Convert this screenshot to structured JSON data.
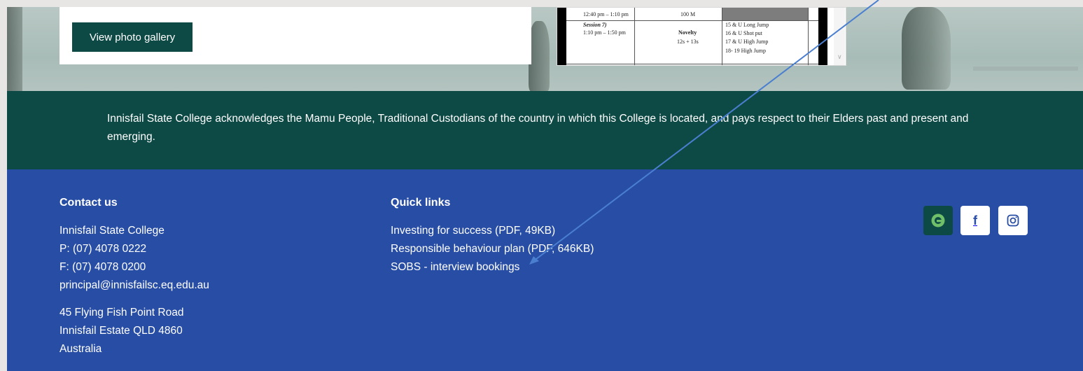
{
  "hero": {
    "gallery_button": "View photo gallery"
  },
  "schedule": {
    "rows": [
      {
        "time": "12:40 pm – 1:10 pm",
        "event": "100 M",
        "events": []
      },
      {
        "session": "Session 7)",
        "time": "1:10 pm – 1:50 pm",
        "event": "Novelty",
        "group": "12s + 13s",
        "events": [
          "15 & U Long Jump",
          "16 & U Shot put",
          "17 & U High Jump",
          "18- 19 High Jump"
        ]
      }
    ]
  },
  "acknowledgement": {
    "text": "Innisfail State College acknowledges the Mamu People, Traditional Custodians of the country in which this College is located, and pays respect to their Elders past and present and emerging."
  },
  "footer": {
    "contact": {
      "heading": "Contact us",
      "school": "Innisfail State College",
      "phone": "P: (07) 4078 0222",
      "fax": "F: (07) 4078 0200",
      "email": "principal@innisfailsc.eq.edu.au",
      "address_line1": "45 Flying Fish Point Road",
      "address_line2": "Innisfail Estate QLD 4860",
      "country": "Australia"
    },
    "quick_links": {
      "heading": "Quick links",
      "items": [
        "Investing for success (PDF, 49KB)",
        "Responsible behaviour plan (PDF, 646KB)",
        "SOBS - interview bookings"
      ]
    },
    "social": [
      {
        "name": "qparents-icon"
      },
      {
        "name": "facebook-icon"
      },
      {
        "name": "instagram-icon"
      }
    ]
  },
  "colors": {
    "green": "#0d4a45",
    "blue": "#284da5",
    "arrow": "#4a7fd0"
  }
}
